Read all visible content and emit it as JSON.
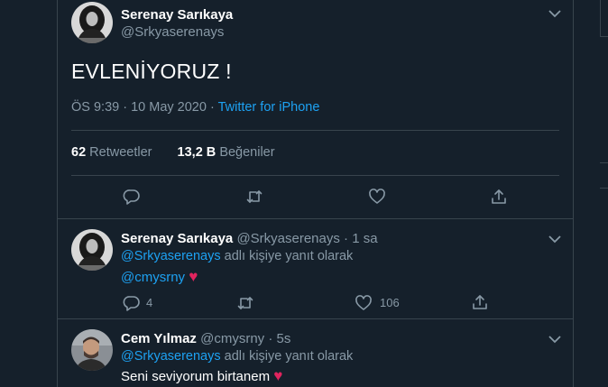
{
  "main_tweet": {
    "author_name": "Serenay Sarıkaya",
    "author_handle": "@Srkyaserenays",
    "text": "EVLENİYORUZ !",
    "time": "ÖS 9:39 · 10 May 2020 ·",
    "source": "Twitter for iPhone",
    "retweets_count": "62",
    "retweets_label": "Retweetler",
    "likes_count": "13,2 B",
    "likes_label": "Beğeniler"
  },
  "reply_1": {
    "author_name": "Serenay Sarıkaya",
    "author_handle": "@Srkyaserenays",
    "time": "· 1 sa",
    "reply_to_handle": "@Srkyaserenays",
    "reply_to_suffix": "adlı kişiye yanıt olarak",
    "text": "@cmysrny",
    "heart": "♥",
    "reply_count": "4",
    "like_count": "106"
  },
  "reply_2": {
    "author_name": "Cem Yılmaz",
    "author_handle": "@cmysrny",
    "time": "· 5s",
    "reply_to_handle": "@Srkyaserenays",
    "reply_to_suffix": "adlı kişiye yanıt olarak",
    "text": "Seni seviyorum birtanem",
    "heart": "♥"
  },
  "colors": {
    "background": "#15202b",
    "border": "#38444d",
    "muted": "#8899a6",
    "link": "#1da1f2",
    "heart": "#e0245e"
  },
  "icons": [
    "chevron-down-icon",
    "reply-icon",
    "retweet-icon",
    "like-icon",
    "share-icon"
  ]
}
